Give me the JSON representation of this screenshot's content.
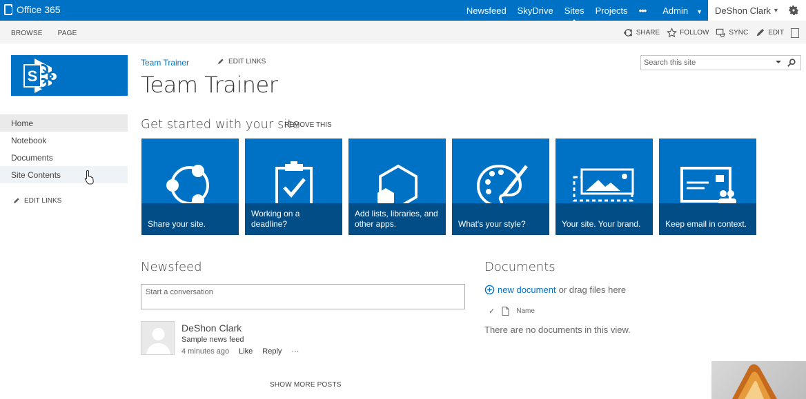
{
  "suitebar": {
    "brand": "Office 365",
    "nav": [
      "Newsfeed",
      "SkyDrive",
      "Sites",
      "Projects"
    ],
    "active_nav": "Sites",
    "more": "•••",
    "admin": "Admin",
    "user": "DeShon Clark",
    "accent": "#0072c6"
  },
  "ribbon": {
    "tabs": [
      "BROWSE",
      "PAGE"
    ],
    "actions": {
      "share": "SHARE",
      "follow": "FOLLOW",
      "sync": "SYNC",
      "edit": "EDIT"
    }
  },
  "quicklaunch": {
    "items": [
      "Home",
      "Notebook",
      "Documents",
      "Site Contents"
    ],
    "edit_links": "EDIT LINKS"
  },
  "header": {
    "breadcrumb": "Team Trainer",
    "edit_links": "EDIT LINKS",
    "title": "Team Trainer",
    "search_placeholder": "Search this site"
  },
  "get_started": {
    "title": "Get started with your site",
    "remove": "REMOVE THIS",
    "tiles": [
      {
        "icon": "share-icon",
        "caption": "Share your site."
      },
      {
        "icon": "clipboard-check-icon",
        "caption": "Working on a deadline?"
      },
      {
        "icon": "apps-hexagon-icon",
        "caption": "Add lists, libraries, and other apps."
      },
      {
        "icon": "palette-icon",
        "caption": "What's your style?"
      },
      {
        "icon": "image-frame-icon",
        "caption": "Your site. Your brand."
      },
      {
        "icon": "contact-card-icon",
        "caption": "Keep email in context."
      }
    ]
  },
  "newsfeed": {
    "title": "Newsfeed",
    "placeholder": "Start a conversation",
    "post": {
      "author": "DeShon Clark",
      "text": "Sample news feed",
      "time": "4 minutes ago",
      "like": "Like",
      "reply": "Reply",
      "more": "···"
    },
    "show_more": "SHOW MORE POSTS"
  },
  "documents": {
    "title": "Documents",
    "new_document": "new document",
    "drag_text": "or drag files here",
    "column_name": "Name",
    "empty": "There are no documents in this view."
  }
}
